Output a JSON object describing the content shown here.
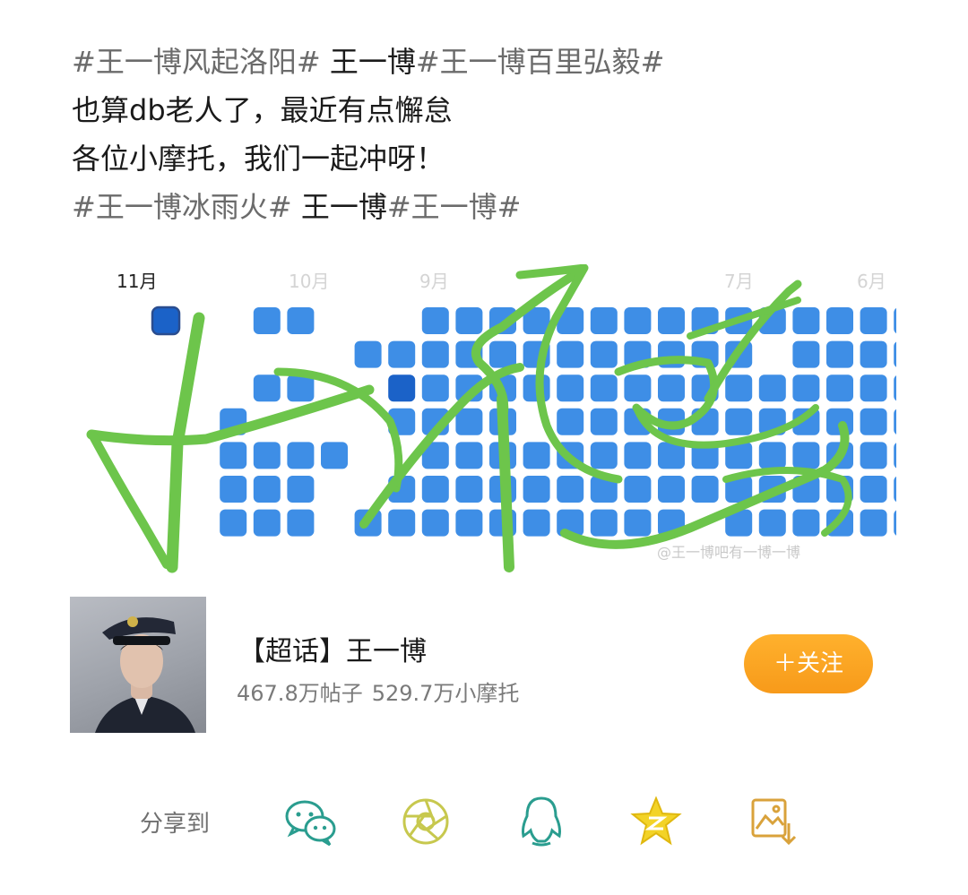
{
  "post": {
    "line1": {
      "tag_a": "#王一博风起洛阳#",
      "mid": " 王一博",
      "tag_b": "#王一博百里弘毅#"
    },
    "line2": "也算db老人了，最近有点懈怠",
    "line3": "各位小摩托，我们一起冲呀！",
    "line4": {
      "tag_a": "#王一博冰雨火#",
      "mid": " 王一博",
      "tag_b": "#王一博#"
    }
  },
  "heatmap": {
    "months": [
      "11月",
      "10月",
      "9月",
      "7月",
      "6月"
    ],
    "active_month": "11月",
    "cell_color": "#3e8ee6",
    "selected_color": "#1b62c8",
    "signature_color": "#6dc54b"
  },
  "watermark": "@王一博吧有一博一博",
  "topic": {
    "title": "【超话】王一博",
    "posts": "467.8万帖子",
    "members": "529.7万小摩托",
    "follow_label": "＋关注"
  },
  "share": {
    "label": "分享到",
    "targets": [
      "wechat-icon",
      "moments-icon",
      "qq-icon",
      "qzone-icon",
      "save-image-icon"
    ],
    "icon_color": "#2a9d8f"
  }
}
